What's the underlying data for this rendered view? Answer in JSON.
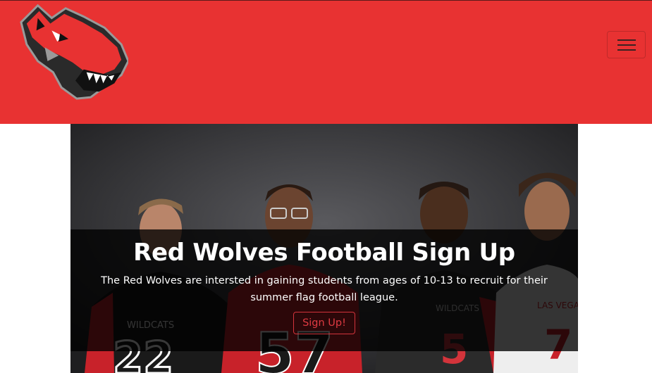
{
  "nav": {
    "logo_icon": "red-wolf-head-logo",
    "menu_icon": "hamburger-menu-icon",
    "brand_color": "#e83232"
  },
  "hero": {
    "image_description_icon": "football-players-photo",
    "title": "Red Wolves Football Sign Up",
    "text": "The Red Wolves are intersted in gaining students from ages of 10-13 to recruit for their summer flag football league.",
    "button_label": "Sign Up!",
    "accent_color": "#d3343b"
  }
}
